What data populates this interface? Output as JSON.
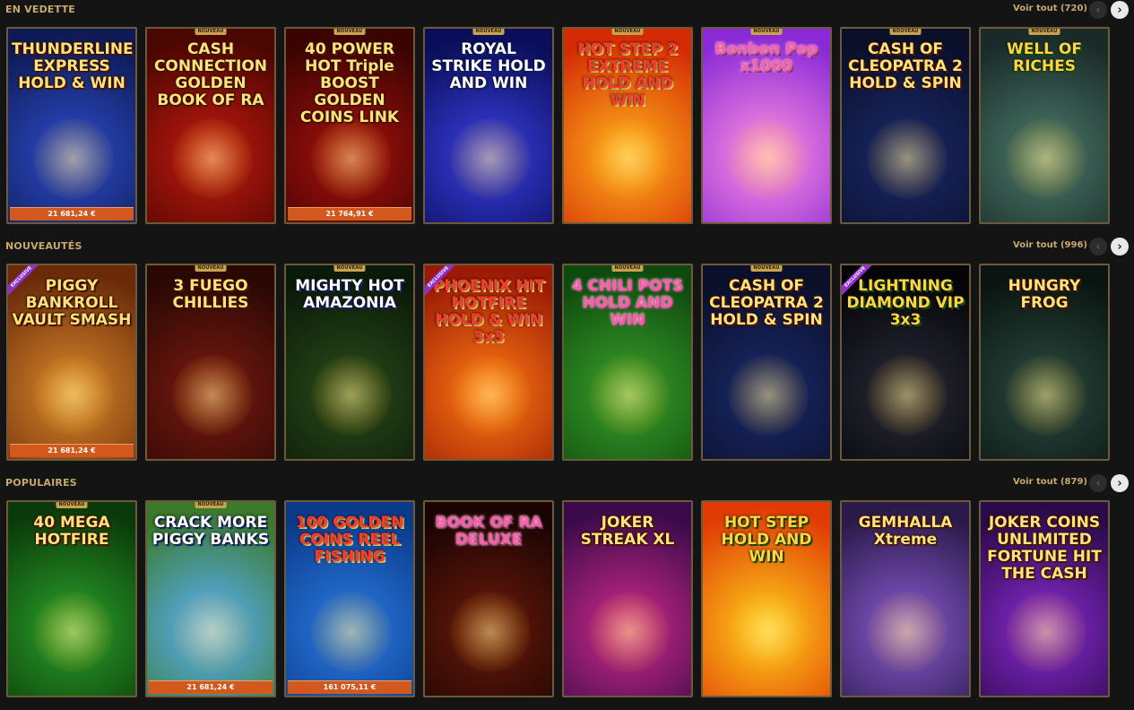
{
  "sections": [
    {
      "title": "EN VEDETTE",
      "see_all": "Voir tout (720)",
      "games": [
        {
          "name": "THUNDERLINE EXPRESS HOLD & WIN",
          "badge": "",
          "jackpot": "21 681,24 €",
          "colors": [
            "#2d4cc9",
            "#0d1a55"
          ]
        },
        {
          "name": "CASH CONNECTION GOLDEN BOOK OF RA",
          "badge": "NOUVEAU",
          "jackpot": "",
          "colors": [
            "#c21a10",
            "#4a0600"
          ]
        },
        {
          "name": "40 POWER HOT Triple BOOST GOLDEN COINS LINK",
          "badge": "NOUVEAU",
          "jackpot": "21 764,91 €",
          "colors": [
            "#a8100c",
            "#3a0402"
          ]
        },
        {
          "name": "ROYAL STRIKE HOLD AND WIN",
          "badge": "NOUVEAU",
          "jackpot": "",
          "colors": [
            "#3a3ee0",
            "#0a0e5a"
          ]
        },
        {
          "name": "HOT STEP 2 EXTREME HOLD AND WIN",
          "badge": "NOUVEAU",
          "jackpot": "",
          "colors": [
            "#ffb21a",
            "#d42a05"
          ]
        },
        {
          "name": "Bonbon Pop x1000",
          "badge": "NOUVEAU",
          "jackpot": "",
          "colors": [
            "#ff8fe0",
            "#8a2ad6"
          ]
        },
        {
          "name": "CASH OF CLEOPATRA 2 HOLD & SPIN",
          "badge": "NOUVEAU",
          "jackpot": "",
          "colors": [
            "#1a2a6a",
            "#0a0f2a"
          ]
        },
        {
          "name": "WELL OF RICHES",
          "badge": "NOUVEAU",
          "jackpot": "",
          "colors": [
            "#4a7a6a",
            "#1a2a28"
          ]
        }
      ]
    },
    {
      "title": "NOUVEAUTÉS",
      "see_all": "Voir tout (996)",
      "games": [
        {
          "name": "PIGGY BANKROLL VAULT SMASH",
          "badge": "EXCLUSIVE",
          "jackpot": "21 681,24 €",
          "colors": [
            "#d8872a",
            "#6a2a0a"
          ]
        },
        {
          "name": "3 FUEGO CHILLIES",
          "badge": "NOUVEAU",
          "jackpot": "",
          "colors": [
            "#7a1a10",
            "#2a0804"
          ]
        },
        {
          "name": "MIGHTY HOT AMAZONIA",
          "badge": "NOUVEAU",
          "jackpot": "",
          "colors": [
            "#2a4a1a",
            "#0a1a08"
          ]
        },
        {
          "name": "PHOENIX HIT HOTFIRE HOLD & WIN 3x3",
          "badge": "EXCLUSIVE",
          "jackpot": "",
          "colors": [
            "#ff7a12",
            "#9a1a05"
          ]
        },
        {
          "name": "4 CHILI POTS HOLD AND WIN",
          "badge": "NOUVEAU",
          "jackpot": "",
          "colors": [
            "#3aa02a",
            "#0e4a0e"
          ]
        },
        {
          "name": "CASH OF CLEOPATRA 2 HOLD & SPIN",
          "badge": "NOUVEAU",
          "jackpot": "",
          "colors": [
            "#1a2a6a",
            "#0a0f2a"
          ]
        },
        {
          "name": "LIGHTNING DIAMOND VIP 3x3",
          "badge": "EXCLUSIVE",
          "jackpot": "",
          "colors": [
            "#2a2a3a",
            "#050508"
          ]
        },
        {
          "name": "HUNGRY FROG",
          "badge": "",
          "jackpot": "",
          "colors": [
            "#2a4a40",
            "#0a1410"
          ]
        }
      ]
    },
    {
      "title": "POPULAIRES",
      "see_all": "Voir tout (879)",
      "games": [
        {
          "name": "40 MEGA HOTFIRE",
          "badge": "NOUVEAU",
          "jackpot": "",
          "colors": [
            "#2aa02a",
            "#0a3a0a"
          ]
        },
        {
          "name": "CRACK MORE PIGGY BANKS",
          "badge": "NOUVEAU",
          "jackpot": "21 681,24 €",
          "colors": [
            "#5ab0ff",
            "#3a7a2a"
          ]
        },
        {
          "name": "100 GOLDEN COINS REEL FISHING",
          "badge": "",
          "jackpot": "161 075,11 €",
          "colors": [
            "#2a7ae0",
            "#0a3a8a"
          ]
        },
        {
          "name": "BOOK OF RA DELUXE",
          "badge": "",
          "jackpot": "",
          "colors": [
            "#6a1a0a",
            "#1a0402"
          ]
        },
        {
          "name": "JOKER STREAK XL",
          "badge": "",
          "jackpot": "",
          "colors": [
            "#d02a8a",
            "#3a0a4a"
          ]
        },
        {
          "name": "HOT STEP HOLD AND WIN",
          "badge": "",
          "jackpot": "",
          "colors": [
            "#ffcf1a",
            "#e03a05"
          ]
        },
        {
          "name": "GEMHALLA Xtreme",
          "badge": "",
          "jackpot": "",
          "colors": [
            "#8a5ad0",
            "#2a1a4a"
          ]
        },
        {
          "name": "JOKER COINS UNLIMITED FORTUNE HIT THE CASH",
          "badge": "",
          "jackpot": "",
          "colors": [
            "#8a2ad0",
            "#2a0a4a"
          ]
        }
      ]
    }
  ],
  "icons": {
    "prev": "chevron-left-icon",
    "next": "chevron-right-icon"
  }
}
